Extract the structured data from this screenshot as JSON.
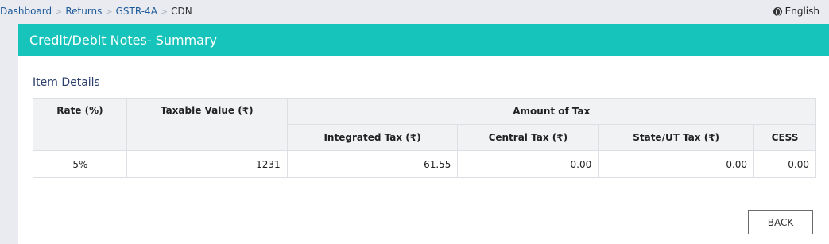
{
  "breadcrumb": {
    "items": [
      "Dashboard",
      "Returns",
      "GSTR-4A"
    ],
    "current": "CDN"
  },
  "language": {
    "icon": "globe-icon",
    "label": "English"
  },
  "panel": {
    "title": "Credit/Debit Notes- Summary",
    "section_title": "Item Details"
  },
  "table": {
    "headers": {
      "rate": "Rate (%)",
      "taxable_value": "Taxable Value (₹)",
      "amount_of_tax": "Amount of Tax",
      "integrated_tax": "Integrated Tax (₹)",
      "central_tax": "Central Tax (₹)",
      "state_ut_tax": "State/UT Tax (₹)",
      "cess": "CESS"
    },
    "rows": [
      {
        "rate": "5%",
        "taxable_value": "1231",
        "integrated_tax": "61.55",
        "central_tax": "0.00",
        "state_ut_tax": "0.00",
        "cess": "0.00"
      }
    ]
  },
  "actions": {
    "back_label": "BACK"
  },
  "colors": {
    "header_bar": "#17c4bb",
    "link": "#1e5a9a",
    "page_bg": "#e9ebf0"
  }
}
